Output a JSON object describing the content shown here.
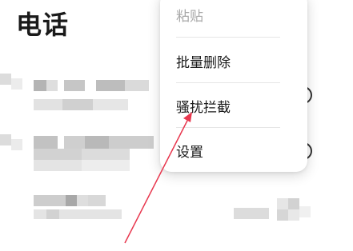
{
  "header": {
    "title": "电话"
  },
  "menu": {
    "items": [
      {
        "label": "粘贴",
        "enabled": false
      },
      {
        "label": "批量删除",
        "enabled": true
      },
      {
        "label": "骚扰拦截",
        "enabled": true
      },
      {
        "label": "设置",
        "enabled": true
      }
    ]
  },
  "call_rows": [
    {
      "info_icon": "info-icon"
    },
    {
      "info_icon": "info-icon"
    },
    {
      "info_icon": null
    }
  ],
  "annotation": {
    "color": "#e8384f",
    "icon": "arrow-icon"
  },
  "colors": {
    "pixel_dark": "#b8b8b8",
    "pixel_mid": "#d4d4d4",
    "pixel_light": "#ececec"
  }
}
